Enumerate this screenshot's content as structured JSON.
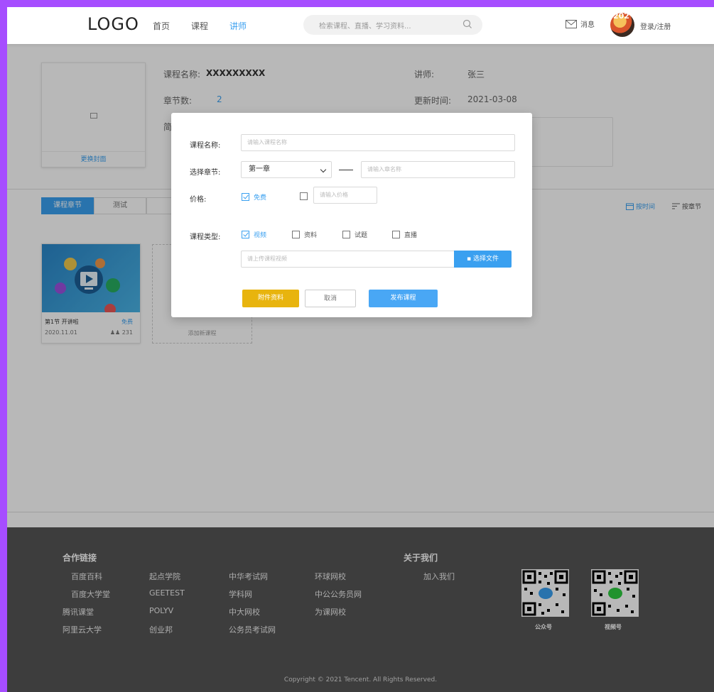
{
  "header": {
    "logo": "LOGO",
    "nav": [
      "首页",
      "课程",
      "讲师"
    ],
    "active_nav": 2,
    "search_placeholder": "检索课程、直播、学习资料...",
    "messages": "消息",
    "avatar_text": "202",
    "login": "登录/注册"
  },
  "course": {
    "change_cover": "更换封面",
    "name_label": "课程名称:",
    "name_value": "XXXXXXXXX",
    "chapters_label": "章节数:",
    "chapters_value": "2",
    "intro_label": "简",
    "teacher_label": "讲师:",
    "teacher_value": "张三",
    "updated_label": "更新时间:",
    "updated_value": "2021-03-08"
  },
  "tabs": [
    "课程章节",
    "测试",
    ""
  ],
  "sort": {
    "by_time": "按时间",
    "by_chapter": "按章节"
  },
  "lessons": [
    {
      "title": "第1节 开讲啦",
      "badge": "免费",
      "date": "2020.11.01",
      "count": "231"
    }
  ],
  "add_lesson": "添加新课程",
  "modal": {
    "name_label": "课程名称:",
    "name_placeholder": "请输入课程名称",
    "chapter_label": "选择章节:",
    "chapter_selected": "第一章",
    "chapter_placeholder": "请输入章名称",
    "price_label": "价格:",
    "price_free": "免费",
    "price_placeholder": "请输入价格",
    "type_label": "课程类型:",
    "types": [
      "视频",
      "资料",
      "试题",
      "直播"
    ],
    "upload_placeholder": "请上传课程视频",
    "select_file": "选择文件",
    "attach_button": "附件资料",
    "cancel_button": "取消",
    "publish_button": "发布课程"
  },
  "footer": {
    "partners_title": "合作链接",
    "about_title": "关于我们",
    "columns": [
      [
        "百度百科",
        "百度大学堂",
        "腾讯课堂",
        "阿里云大学"
      ],
      [
        "起点学院",
        "GEETEST",
        "POLYV",
        "创业邦"
      ],
      [
        "中华考试网",
        "学科网",
        "中大网校",
        "公务员考试网"
      ],
      [
        "环球网校",
        "中公公务员网",
        "为课网校"
      ]
    ],
    "join_us": "加入我们",
    "qr_labels": [
      "公众号",
      "视频号"
    ],
    "copyright": "Copyright © 2021 Tencent. All Rights Reserved."
  },
  "colors": {
    "accent": "#3aa0f0",
    "frame": "#a64dff",
    "footer": "#555555",
    "attach": "#e8b40e"
  }
}
